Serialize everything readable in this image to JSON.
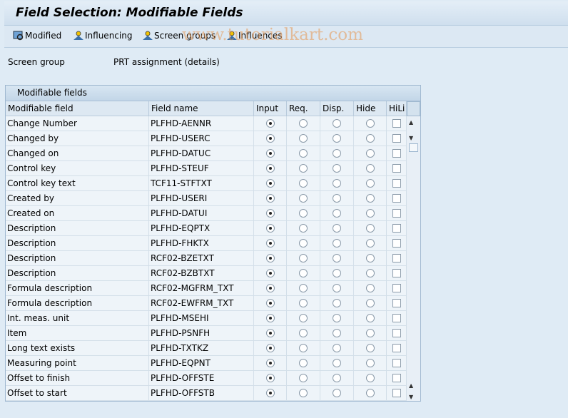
{
  "title": "Field Selection: Modifiable Fields",
  "toolbar": {
    "modified": "Modified",
    "influencing": "Influencing",
    "screen_groups": "Screen groups",
    "influences": "Influences"
  },
  "watermark": "www.tutorialkart.com",
  "screen_group": {
    "label": "Screen group",
    "value": "PRT assignment (details)"
  },
  "table": {
    "title": "Modifiable fields",
    "columns": [
      "Modifiable field",
      "Field name",
      "Input",
      "Req.",
      "Disp.",
      "Hide",
      "HiLi"
    ],
    "rows": [
      {
        "field": "Change Number",
        "name": "PLFHD-AENNR",
        "sel": "Input",
        "hili": false
      },
      {
        "field": "Changed by",
        "name": "PLFHD-USERC",
        "sel": "Input",
        "hili": false
      },
      {
        "field": "Changed on",
        "name": "PLFHD-DATUC",
        "sel": "Input",
        "hili": false
      },
      {
        "field": "Control key",
        "name": "PLFHD-STEUF",
        "sel": "Input",
        "hili": false
      },
      {
        "field": "Control key text",
        "name": "TCF11-STFTXT",
        "sel": "Input",
        "hili": false
      },
      {
        "field": "Created by",
        "name": "PLFHD-USERI",
        "sel": "Input",
        "hili": false
      },
      {
        "field": "Created on",
        "name": "PLFHD-DATUI",
        "sel": "Input",
        "hili": false
      },
      {
        "field": "Description",
        "name": "PLFHD-EQPTX",
        "sel": "Input",
        "hili": false
      },
      {
        "field": "Description",
        "name": "PLFHD-FHKTX",
        "sel": "Input",
        "hili": false
      },
      {
        "field": "Description",
        "name": "RCF02-BZETXT",
        "sel": "Input",
        "hili": false
      },
      {
        "field": "Description",
        "name": "RCF02-BZBTXT",
        "sel": "Input",
        "hili": false
      },
      {
        "field": "Formula description",
        "name": "RCF02-MGFRM_TXT",
        "sel": "Input",
        "hili": false
      },
      {
        "field": "Formula description",
        "name": "RCF02-EWFRM_TXT",
        "sel": "Input",
        "hili": false
      },
      {
        "field": "Int. meas. unit",
        "name": "PLFHD-MSEHI",
        "sel": "Input",
        "hili": false
      },
      {
        "field": "Item",
        "name": "PLFHD-PSNFH",
        "sel": "Input",
        "hili": false
      },
      {
        "field": "Long text exists",
        "name": "PLFHD-TXTKZ",
        "sel": "Input",
        "hili": false
      },
      {
        "field": "Measuring point",
        "name": "PLFHD-EQPNT",
        "sel": "Input",
        "hili": false
      },
      {
        "field": "Offset to finish",
        "name": "PLFHD-OFFSTE",
        "sel": "Input",
        "hili": false
      },
      {
        "field": "Offset to start",
        "name": "PLFHD-OFFSTB",
        "sel": "Input",
        "hili": false
      }
    ]
  }
}
